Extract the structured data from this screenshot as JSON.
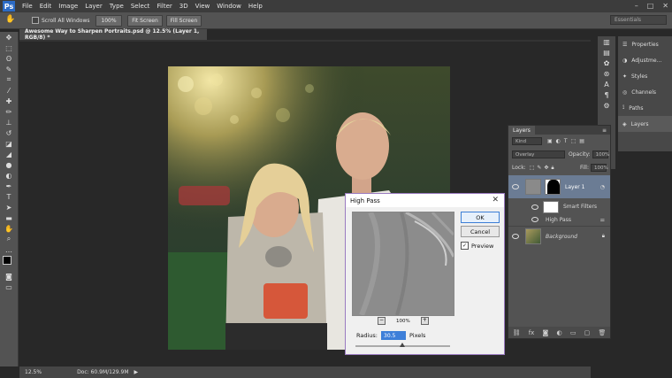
{
  "app": {
    "logo": "Ps",
    "menu": [
      "File",
      "Edit",
      "Image",
      "Layer",
      "Type",
      "Select",
      "Filter",
      "3D",
      "View",
      "Window",
      "Help"
    ]
  },
  "options_bar": {
    "scroll_all_windows": "Scroll All Windows",
    "zoom_100": "100%",
    "fit_screen": "Fit Screen",
    "fill_screen": "Fill Screen",
    "workspace": "Essentials"
  },
  "document": {
    "tab_title": "Awesome Way to Sharpen Portraits.psd @ 12.5% (Layer 1, RGB/8) *",
    "zoom": "12.5%",
    "doc_size": "Doc: 60.9M/129.9M"
  },
  "right_dock": {
    "items": [
      "Properties",
      "Adjustme...",
      "Styles",
      "Channels",
      "Paths",
      "Layers"
    ]
  },
  "layers_panel": {
    "tab": "Layers",
    "kind_filter": "Kind",
    "blend_mode": "Overlay",
    "opacity_label": "Opacity:",
    "opacity_value": "100%",
    "lock_label": "Lock:",
    "fill_label": "Fill:",
    "fill_value": "100%",
    "layers": [
      {
        "name": "Layer 1"
      },
      {
        "name": "Smart Filters"
      },
      {
        "name": "High Pass"
      },
      {
        "name": "Background"
      }
    ]
  },
  "high_pass": {
    "title": "High Pass",
    "ok": "OK",
    "cancel": "Cancel",
    "preview_label": "Preview",
    "zoom_level": "100%",
    "radius_label": "Radius:",
    "radius_value": "30.5",
    "units": "Pixels"
  },
  "colors": {
    "accent": "#3d7fd9",
    "panel_bg": "#535353",
    "app_bg": "#282828"
  }
}
